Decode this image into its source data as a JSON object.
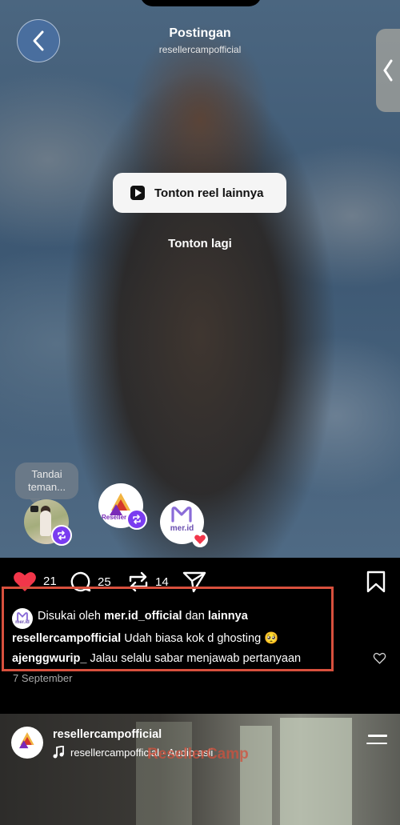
{
  "header": {
    "title": "Postingan",
    "subtitle": "resellercampofficial"
  },
  "overlay": {
    "watch_more_label": "Tonton reel lainnya",
    "watch_again_label": "Tonton lagi"
  },
  "tag": {
    "label_line1": "Tandai",
    "label_line2": "teman..."
  },
  "avatars": {
    "reseller_label": "Reseller",
    "mer_label": "mer.id"
  },
  "actions": {
    "likes": "21",
    "comments": "25",
    "reposts": "14"
  },
  "caption": {
    "liked_prefix": "Disukai oleh",
    "liked_user": "mer.id_official",
    "liked_and": "dan",
    "liked_others": "lainnya",
    "author": "resellercampofficial",
    "text": "Udah biasa kok d ghosting 🥺",
    "comment_user": "ajenggwurip_",
    "comment_text": "Jalau selalu sabar menjawab pertanyaan"
  },
  "date": "7 September",
  "next_post": {
    "username": "resellercampofficial",
    "audio": "resellercampofficial · Audio asli",
    "watermark": "ResellerCamp"
  },
  "colors": {
    "highlight_border": "#d8503d",
    "like_red": "#f2364a",
    "repost_purple": "#7a3cf0"
  }
}
